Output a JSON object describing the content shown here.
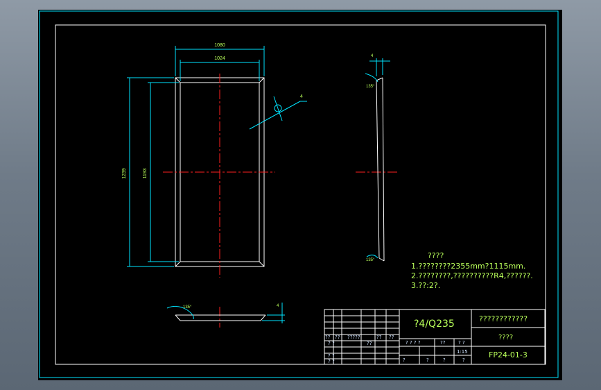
{
  "drawing": {
    "dimensions": {
      "width_outer": "1080",
      "width_inner": "1024",
      "height_outer": "1239",
      "height_inner": "1193",
      "chamfer": "4",
      "edge_thickness": "4",
      "thickness_top": "4",
      "angle_top": "135°",
      "angle_bottom": "135°",
      "angle_bottom_view": "135°"
    },
    "notes": {
      "title": "????",
      "lines": [
        "1.????????2355mm?1115mm.",
        "2.????????,??????????R4,??????.",
        "3.??:2?."
      ]
    },
    "title_block": {
      "material": "?4/Q235",
      "drawing_name": "????????????",
      "part_name": "????",
      "drawing_number": "FP24-01-3",
      "scale": "1:15",
      "header_cells": [
        "??",
        "??",
        "?????",
        "??",
        "??"
      ],
      "row_cells_1": [
        "? ?",
        "??"
      ],
      "row_cells_2": [
        "? ?",
        "? ?"
      ],
      "mid_labels": [
        "? ? ? ?",
        "??",
        "? ?"
      ],
      "bottom_labels": [
        "?",
        "?",
        "?",
        "?"
      ]
    }
  }
}
